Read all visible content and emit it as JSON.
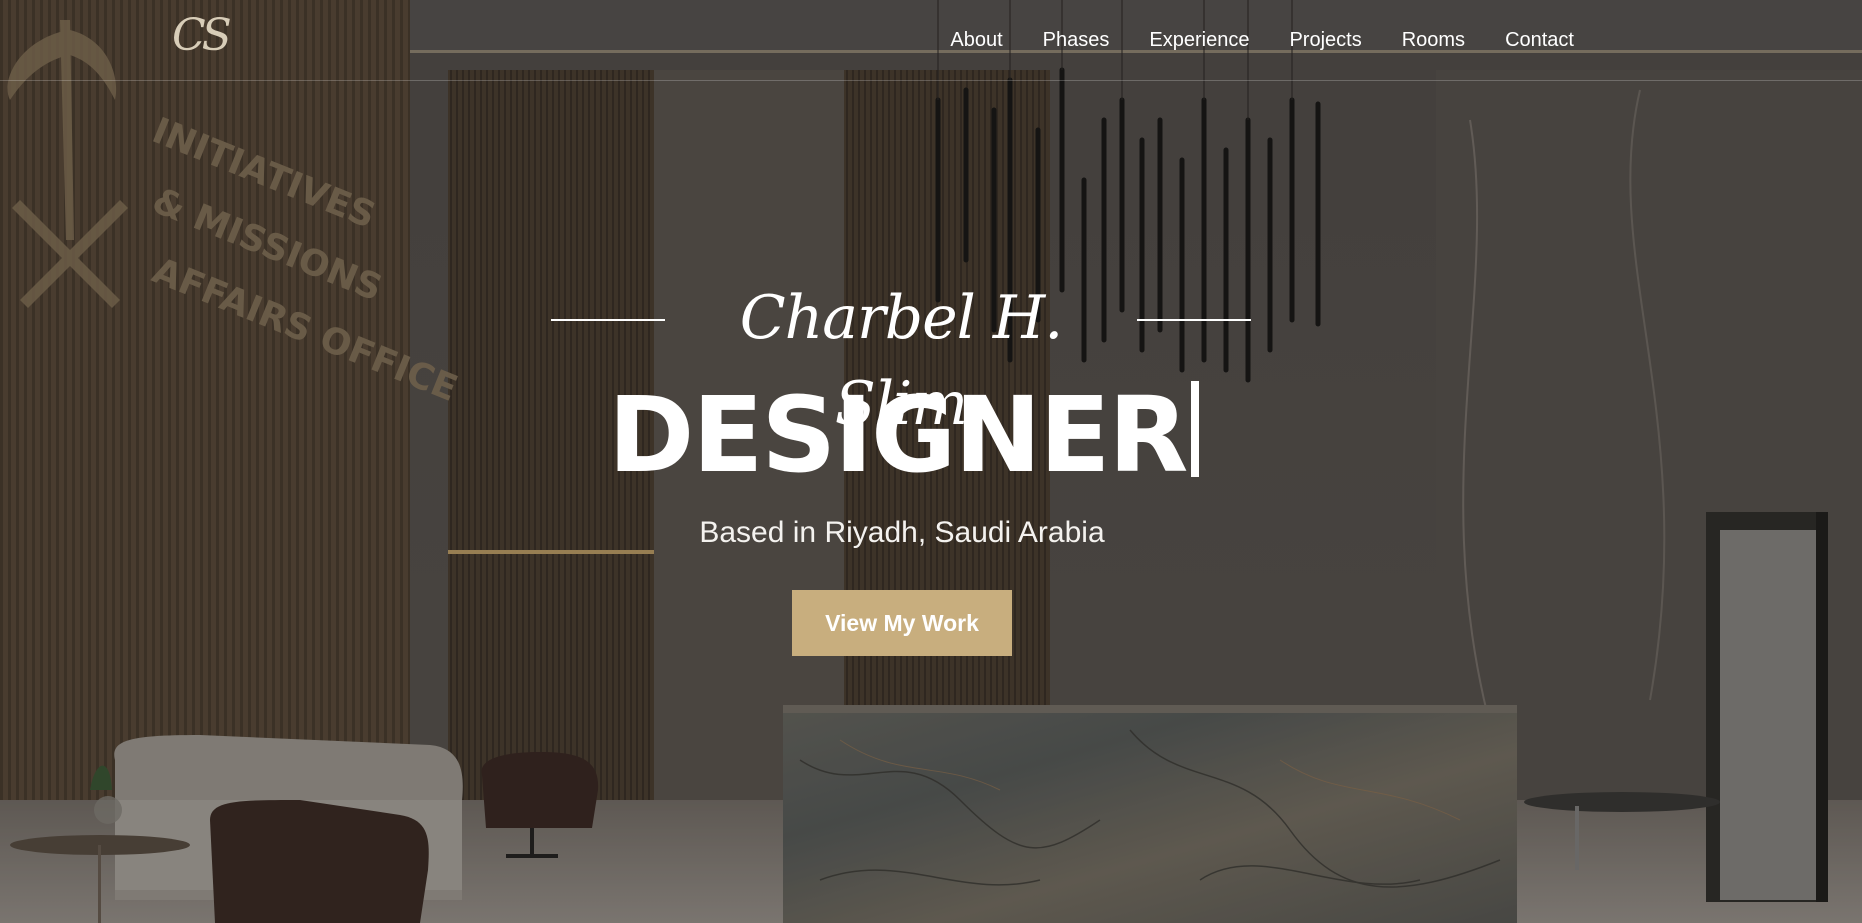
{
  "brand": {
    "logo_text": "CS"
  },
  "nav": {
    "items": [
      {
        "label": "About"
      },
      {
        "label": "Phases"
      },
      {
        "label": "Experience"
      },
      {
        "label": "Projects"
      },
      {
        "label": "Rooms"
      },
      {
        "label": "Contact"
      }
    ]
  },
  "hero": {
    "signature": "Charbel H. Slim",
    "role": "DESIGNER",
    "location": "Based in Riyadh, Saudi Arabia",
    "cta_label": "View My Work",
    "background_image": "hotel-lobby-reception-photo",
    "wall_sign": [
      "INITIATIVES",
      "& MISSIONS",
      "AFFAIRS OFFICE"
    ]
  },
  "colors": {
    "accent": "#c8ae7e",
    "text": "#ffffff",
    "overlay": "#141210"
  }
}
